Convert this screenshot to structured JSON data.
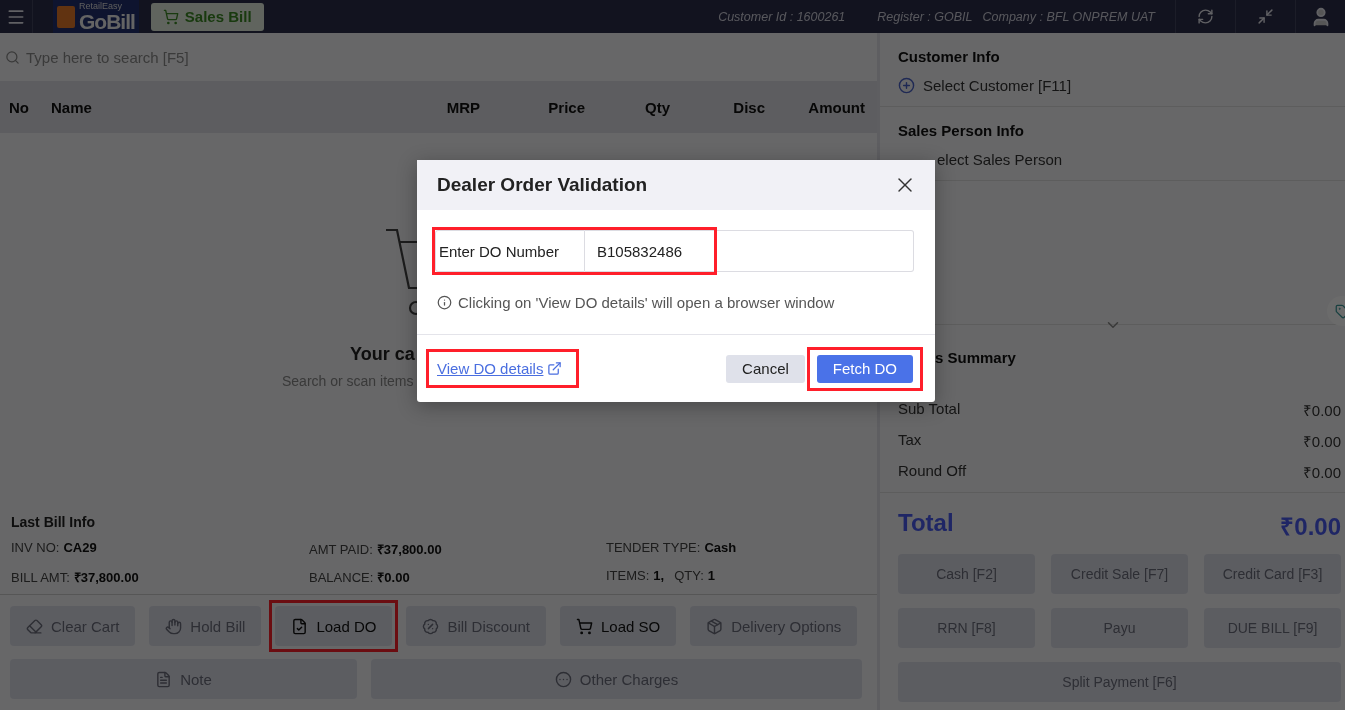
{
  "top_bar": {
    "logo_top": "RetailEasy",
    "logo_main": "GoBill",
    "tabs": [
      {
        "label": "Sales Bill",
        "selected": true
      }
    ],
    "info": [
      "Customer Id : 1600261",
      "Register : GOBIL",
      "Company : BFL ONPREM UAT"
    ]
  },
  "search": {
    "placeholder": "Type here to search [F5]"
  },
  "table": {
    "columns": [
      "No",
      "Name",
      "MRP",
      "Price",
      "Qty",
      "Disc",
      "Amount"
    ]
  },
  "empty_cart": {
    "title": "Your ca",
    "subtitle": "Search or scan items"
  },
  "last_bill": {
    "title": "Last Bill Info",
    "cells": [
      [
        {
          "label": "INV NO:",
          "value": "CA29"
        }
      ],
      [
        {
          "label": "AMT PAID:",
          "value": "₹37,800.00"
        }
      ],
      [
        {
          "label": "TENDER TYPE:",
          "value": "Cash"
        }
      ],
      [
        {
          "label": "BILL AMT:",
          "value": "₹37,800.00"
        }
      ],
      [
        {
          "label": "BALANCE:",
          "value": "₹0.00"
        }
      ],
      [
        {
          "label": "ITEMS:",
          "value": "1,"
        },
        {
          "label": "QTY:",
          "value": "1"
        }
      ]
    ]
  },
  "actions": [
    {
      "label": "Clear Cart",
      "kind": "clear",
      "disabled": true,
      "highlighted": false
    },
    {
      "label": "Hold Bill",
      "kind": "hold",
      "disabled": true,
      "highlighted": false
    },
    {
      "label": "Load DO",
      "kind": "load_do",
      "disabled": false,
      "highlighted": true
    },
    {
      "label": "Bill Discount",
      "kind": "discount",
      "disabled": true,
      "highlighted": false
    },
    {
      "label": "Load SO",
      "kind": "load_so",
      "disabled": false,
      "highlighted": false
    },
    {
      "label": "Delivery Options",
      "kind": "delivery",
      "disabled": true,
      "highlighted": false
    }
  ],
  "extra_actions": [
    {
      "label": "Note",
      "kind": "note",
      "disabled": true
    },
    {
      "label": "Other Charges",
      "kind": "other",
      "disabled": true
    }
  ],
  "customer_info": {
    "title": "Customer Info",
    "action": "Select Customer [F11]"
  },
  "sales_person_info": {
    "title": "Sales Person Info",
    "action": "elect Sales Person"
  },
  "summary": {
    "title": "s Summary",
    "rows": [
      {
        "label": "Sub Total",
        "value": "₹0.00"
      },
      {
        "label": "Tax",
        "value": "₹0.00"
      },
      {
        "label": "Round Off",
        "value": "₹0.00"
      }
    ],
    "total_label": "Total",
    "total_value": "₹0.00"
  },
  "payments": [
    {
      "label": "Cash [F2]",
      "disabled": true
    },
    {
      "label": "Credit Sale [F7]",
      "disabled": true
    },
    {
      "label": "Credit Card [F3]",
      "disabled": true
    },
    {
      "label": "RRN [F8]",
      "disabled": true
    },
    {
      "label": "Payu",
      "disabled": true
    },
    {
      "label": "DUE BILL [F9]",
      "disabled": true
    },
    {
      "label": "Split Payment [F6]",
      "disabled": true
    }
  ],
  "dialog": {
    "title": "Dealer Order Validation",
    "field": {
      "label": "Enter DO Number",
      "value": "B105832486",
      "highlighted": true
    },
    "note": "Clicking on 'View DO details' will open a browser window",
    "link": {
      "label": "View DO details",
      "highlighted": true
    },
    "buttons": [
      {
        "label": "Cancel",
        "kind": "secondary",
        "highlighted": false
      },
      {
        "label": "Fetch DO",
        "kind": "primary",
        "highlighted": true
      }
    ]
  }
}
